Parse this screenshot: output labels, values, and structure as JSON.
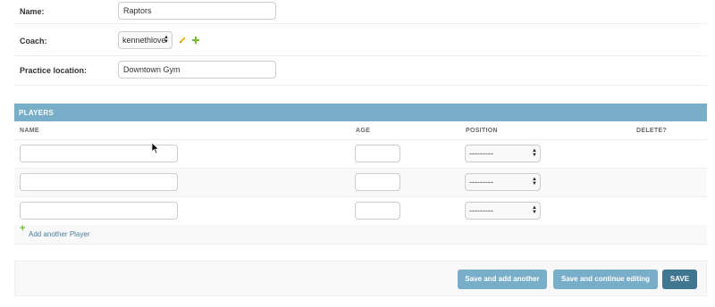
{
  "form": {
    "name_label": "Name:",
    "name_value": "Raptors",
    "coach_label": "Coach:",
    "coach_value": "kennethlove",
    "location_label": "Practice location:",
    "location_value": "Downtown Gym"
  },
  "players": {
    "title": "PLAYERS",
    "columns": {
      "name": "NAME",
      "age": "AGE",
      "position": "POSITION",
      "delete": "DELETE?"
    },
    "rows": [
      {
        "name": "",
        "age": "",
        "position": "---------"
      },
      {
        "name": "",
        "age": "",
        "position": "---------"
      },
      {
        "name": "",
        "age": "",
        "position": "---------"
      }
    ],
    "add_label": "Add another Player"
  },
  "actions": {
    "save_add": "Save and add another",
    "save_continue": "Save and continue editing",
    "save": "SAVE"
  },
  "colors": {
    "header_bg": "#79aec8",
    "button_light": "#79aec8",
    "button_dark": "#417690",
    "link": "#447e9b",
    "add_green": "#70bf2b",
    "edit_yellow": "#efb80b"
  },
  "icons": {
    "edit": "pencil-icon",
    "add": "plus-icon",
    "cursor": "mouse-pointer-icon"
  }
}
